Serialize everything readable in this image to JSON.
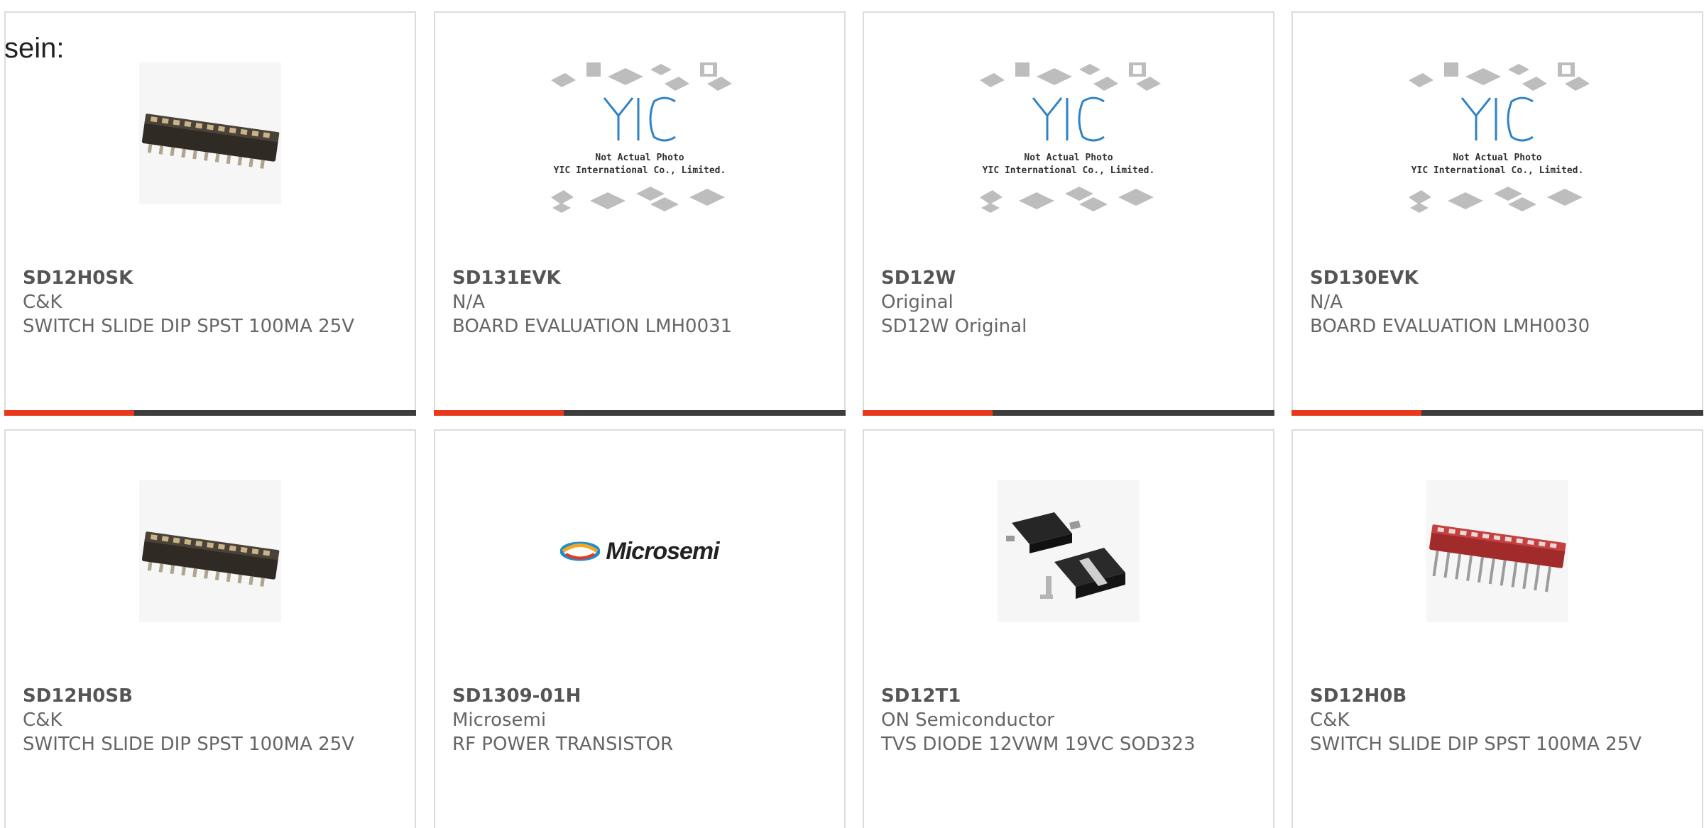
{
  "intro_text": "sein:",
  "cards": [
    {
      "part": "SD12H0SK",
      "mfr": "C&K",
      "desc": "SWITCH SLIDE DIP SPST 100MA 25V",
      "image": "dip-switch-black"
    },
    {
      "part": "SD131EVK",
      "mfr": "N/A",
      "desc": "BOARD EVALUATION LMH0031",
      "image": "yic-placeholder"
    },
    {
      "part": "SD12W",
      "mfr": "Original",
      "desc": "SD12W Original",
      "image": "yic-placeholder"
    },
    {
      "part": "SD130EVK",
      "mfr": "N/A",
      "desc": "BOARD EVALUATION LMH0030",
      "image": "yic-placeholder"
    },
    {
      "part": "SD12H0SB",
      "mfr": "C&K",
      "desc": "SWITCH SLIDE DIP SPST 100MA 25V",
      "image": "dip-switch-black"
    },
    {
      "part": "SD1309-01H",
      "mfr": "Microsemi",
      "desc": "RF POWER TRANSISTOR",
      "image": "microsemi-logo"
    },
    {
      "part": "SD12T1",
      "mfr": "ON Semiconductor",
      "desc": "TVS DIODE 12VWM 19VC SOD323",
      "image": "sod323-diode"
    },
    {
      "part": "SD12H0B",
      "mfr": "C&K",
      "desc": "SWITCH SLIDE DIP SPST 100MA 25V",
      "image": "dip-switch-red"
    }
  ],
  "placeholder": {
    "logo": "YIC",
    "line1": "Not Actual Photo",
    "line2": "YIC International Co., Limited."
  },
  "microsemi": {
    "wordmark": "Microsemi"
  },
  "colors": {
    "accent": "#e8391c",
    "bar": "#3d3d3d",
    "border": "#dcdcdc"
  }
}
